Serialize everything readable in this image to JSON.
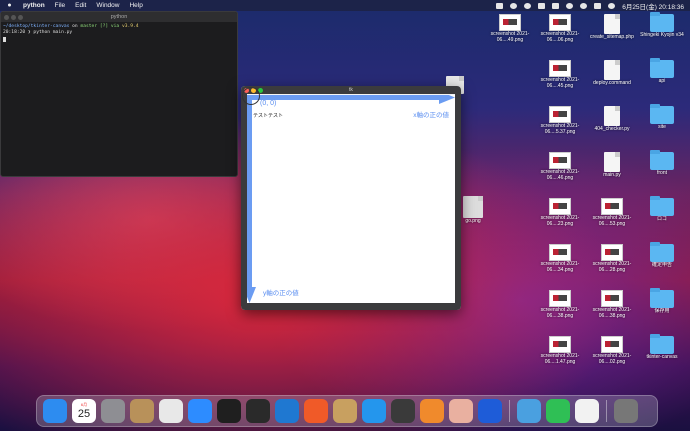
{
  "menubar": {
    "app_name": "python",
    "items": [
      "File",
      "Edit",
      "Window",
      "Help"
    ],
    "datetime": "6月25日(金)  20:18:36"
  },
  "terminal": {
    "title": "python",
    "line1_path": "~/desktop/tkinter-canvas",
    "line1_on": " on ",
    "line1_branch": "master [?] via",
    "line1_version": " v3.9.4",
    "line2": "20:18:20 ❯ python main.py"
  },
  "tk_window": {
    "title": "tk",
    "origin_label": "(0, 0)",
    "text_label": "テストテスト",
    "x_axis_label": "x軸の正の値",
    "y_axis_label": "y軸の正の値",
    "arrow_color": "#6b9cf2"
  },
  "desktop": {
    "partial_file": "go.png",
    "icons": [
      {
        "label": "screenshot 2021-06....49.png",
        "type": "thumb"
      },
      {
        "label": "screenshot 2021-06....06.png",
        "type": "thumb"
      },
      {
        "label": "create_sitemap.php",
        "type": "doc"
      },
      {
        "label": "Shingeki Kyojin v34",
        "type": "folder"
      },
      {
        "label": "screenshot 2021-06....45.png",
        "type": "thumb"
      },
      {
        "label": "deploy.command",
        "type": "doc"
      },
      {
        "label": "api",
        "type": "folder"
      },
      {
        "label": "screenshot 2021-06....5.37.png",
        "type": "thumb"
      },
      {
        "label": "404_checker.py",
        "type": "doc"
      },
      {
        "label": "site",
        "type": "folder"
      },
      {
        "label": "screenshot 2021-06....46.png",
        "type": "thumb"
      },
      {
        "label": "main.py",
        "type": "doc"
      },
      {
        "label": "front",
        "type": "folder"
      },
      {
        "label": "screenshot 2021-06....23.png",
        "type": "thumb"
      },
      {
        "label": "screenshot 2021-06....53.png",
        "type": "thumb"
      },
      {
        "label": "ロゴ",
        "type": "folder"
      },
      {
        "label": "screenshot 2021-06....34.png",
        "type": "thumb"
      },
      {
        "label": "screenshot 2021-06....28.png",
        "type": "thumb"
      },
      {
        "label": "確定申告",
        "type": "folder"
      },
      {
        "label": "screenshot 2021-06....38.png",
        "type": "thumb"
      },
      {
        "label": "screenshot 2021-06....38.png",
        "type": "thumb"
      },
      {
        "label": "保存用",
        "type": "folder"
      },
      {
        "label": "screenshot 2021-06....1.47.png",
        "type": "thumb"
      },
      {
        "label": "screenshot 2021-06....02.png",
        "type": "thumb"
      },
      {
        "label": "tkinter-canvas",
        "type": "folder"
      }
    ]
  },
  "dock": {
    "calendar_month": "6月",
    "calendar_day": "25",
    "apps": [
      {
        "name": "finder-icon",
        "color": "#2d8cf0"
      },
      {
        "name": "calendar-icon",
        "color": "#ffffff"
      },
      {
        "name": "system-preferences-icon",
        "color": "#8e8e93"
      },
      {
        "name": "archive-icon",
        "color": "#b8915a"
      },
      {
        "name": "chrome-icon",
        "color": "#e8e8e8"
      },
      {
        "name": "zoom-icon",
        "color": "#2d8cff"
      },
      {
        "name": "terminal-icon",
        "color": "#1f1f1f"
      },
      {
        "name": "terminal-2-icon",
        "color": "#2a2a2a"
      },
      {
        "name": "vscode-icon",
        "color": "#1f78d1"
      },
      {
        "name": "chart-app-icon",
        "color": "#f05a28"
      },
      {
        "name": "unarchiver-icon",
        "color": "#c8a060"
      },
      {
        "name": "docker-icon",
        "color": "#2496ed"
      },
      {
        "name": "quicktime-icon",
        "color": "#3a3a3a"
      },
      {
        "name": "sourcetree-icon",
        "color": "#f08a2c"
      },
      {
        "name": "python-launcher-icon",
        "color": "#e9b0a0"
      },
      {
        "name": "infinity-icon",
        "color": "#1e5cd8"
      },
      {
        "name": "preview-icon",
        "color": "#4aa0e0"
      },
      {
        "name": "numbers-icon",
        "color": "#2fbf55"
      },
      {
        "name": "document-icon",
        "color": "#f2f2f2"
      },
      {
        "name": "trash-icon",
        "color": "#777777"
      }
    ]
  }
}
